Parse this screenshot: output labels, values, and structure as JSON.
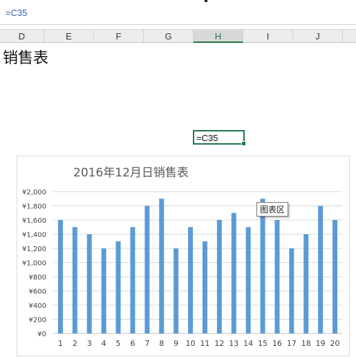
{
  "formula_bar": {
    "formula": "=C35"
  },
  "columns": [
    {
      "label": "D",
      "selected": false
    },
    {
      "label": "E",
      "selected": false
    },
    {
      "label": "F",
      "selected": false
    },
    {
      "label": "G",
      "selected": false
    },
    {
      "label": "H",
      "selected": true
    },
    {
      "label": "I",
      "selected": false
    },
    {
      "label": "J",
      "selected": false
    }
  ],
  "sheet": {
    "title": "销售表",
    "active_cell_text": "=C35"
  },
  "tooltip": {
    "text": "图表区"
  },
  "colors": {
    "bar": "#5b9bd5",
    "selection": "#217346",
    "formula_text": "#2f5fb0"
  },
  "chart_data": {
    "type": "bar",
    "title": "2016年12月日销售表",
    "categories": [
      "1",
      "2",
      "3",
      "4",
      "5",
      "6",
      "7",
      "8",
      "9",
      "10",
      "11",
      "12",
      "13",
      "14",
      "15",
      "16",
      "17",
      "18",
      "19",
      "20"
    ],
    "values": [
      1600,
      1500,
      1400,
      1200,
      1300,
      1500,
      1800,
      1900,
      1200,
      1500,
      1300,
      1600,
      1700,
      1500,
      1900,
      1600,
      1200,
      1400,
      1800,
      1600
    ],
    "ylim": [
      0,
      2000
    ],
    "yticks": [
      "¥0",
      "¥200",
      "¥400",
      "¥600",
      "¥800",
      "¥1,000",
      "¥1,200",
      "¥1,400",
      "¥1,600",
      "¥1,800",
      "¥2,000"
    ],
    "grid": true,
    "xlabel": "",
    "ylabel": ""
  }
}
